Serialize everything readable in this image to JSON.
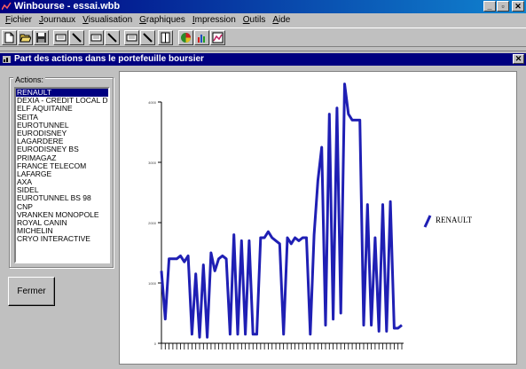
{
  "window": {
    "title": "Winbourse - essai.wbb",
    "btn_minimize": "_",
    "btn_restore": "▫",
    "btn_close": "✕"
  },
  "menu": [
    {
      "underline": "F",
      "rest": "ichier"
    },
    {
      "underline": "J",
      "rest": "ournaux"
    },
    {
      "underline": "V",
      "rest": "isualisation"
    },
    {
      "underline": "G",
      "rest": "raphiques"
    },
    {
      "underline": "I",
      "rest": "mpression"
    },
    {
      "underline": "O",
      "rest": "utils"
    },
    {
      "underline": "A",
      "rest": "ide"
    }
  ],
  "toolbar": {
    "buttons": [
      "new-doc-icon",
      "open-folder-icon",
      "save-disk-icon",
      "edit-journal-icon",
      "pen-icon",
      "edit-journal-2-icon",
      "pen-2-icon",
      "edit-journal-3-icon",
      "pen-3-icon",
      "book-icon",
      "pie-chart-icon",
      "bar-chart-icon",
      "chart-options-icon"
    ]
  },
  "dialog": {
    "title": "Part des actions dans le portefeuille boursier",
    "close": "✕",
    "group_label": "Actions:",
    "fermer_label": "Fermer"
  },
  "actions": [
    "RENAULT",
    "DEXIA - CREDIT LOCAL DE",
    "ELF AQUITAINE",
    "SEITA",
    "EUROTUNNEL",
    "EURODISNEY",
    "LAGARDERE",
    "EURODISNEY BS",
    "PRIMAGAZ",
    "FRANCE TELECOM",
    "LAFARGE",
    "AXA",
    "SIDEL",
    "EUROTUNNEL BS 98",
    "CNP",
    "VRANKEN MONOPOLE",
    "ROYAL CANIN",
    "MICHELIN",
    "CRYO INTERACTIVE"
  ],
  "selected_index": 0,
  "colors": {
    "title_start": "#000080",
    "title_end": "#1084d0",
    "series": "#1f1fb4",
    "selection": "#000080"
  },
  "chart_data": {
    "type": "line",
    "ylim": [
      0,
      4000
    ],
    "yticks": [
      "0",
      "1000",
      "2000",
      "3000",
      "4000"
    ],
    "legend_position": "right",
    "grid": false,
    "series": [
      {
        "name": "RENAULT",
        "values": [
          1200,
          400,
          1400,
          1400,
          1400,
          1450,
          1350,
          1450,
          150,
          1150,
          100,
          1300,
          100,
          1500,
          1200,
          1400,
          1450,
          1400,
          150,
          1800,
          150,
          1700,
          150,
          1700,
          150,
          150,
          1750,
          1750,
          1850,
          1750,
          1700,
          1650,
          150,
          1750,
          1650,
          1750,
          1700,
          1750,
          1750,
          150,
          1800,
          2700,
          3250,
          300,
          3800,
          400,
          3900,
          500,
          4300,
          3800,
          3700,
          3700,
          3700,
          300,
          2300,
          300,
          1750,
          200,
          2300,
          200,
          2350,
          250,
          250,
          300
        ]
      }
    ]
  }
}
